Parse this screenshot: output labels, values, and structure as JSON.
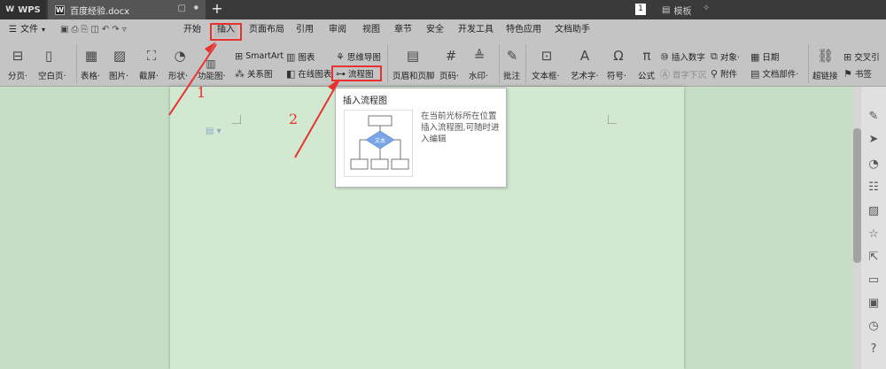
{
  "titlebar": {
    "app_name": "WPS",
    "doc_tab": "百度经验.docx",
    "doc_tab_icon": "W",
    "close_glyph": "▢",
    "dot_glyph": "●",
    "page_count": "1",
    "template_label": "模板"
  },
  "menubar": {
    "file_label": "文件",
    "tabs": [
      "开始",
      "插入",
      "页面布局",
      "引用",
      "审阅",
      "视图",
      "章节",
      "安全",
      "开发工具",
      "特色应用",
      "文档助手"
    ],
    "active_tab": "插入"
  },
  "ribbon": {
    "page_break": "分页·",
    "blank_page": "空白页·",
    "table": "表格·",
    "picture": "图片·",
    "screenshot": "截屏·",
    "shape": "形状·",
    "function_chart": "功能图·",
    "smartart": "SmartArt",
    "chart": "图表",
    "mind_map": "思维导图",
    "relation_map": "关系图",
    "online_chart": "在线图表",
    "flowchart": "流程图",
    "header_footer": "页眉和页脚",
    "page_number": "页码·",
    "watermark": "水印·",
    "comment": "批注",
    "text_box": "文本框·",
    "word_art": "艺术字·",
    "symbol": "符号·",
    "formula": "公式",
    "insert_number": "插入数字",
    "object": "对象·",
    "date": "日期",
    "drop_cap": "首字下沉",
    "attachment": "附件",
    "doc_parts": "文档部件·",
    "hyperlink": "超链接",
    "cross_ref": "交叉引",
    "bookmark": "书签"
  },
  "popup": {
    "title": "插入流程图",
    "preview_label": "文本",
    "description": "在当前光标所在位置插入流程图,可随时进入编辑"
  },
  "annotations": {
    "step1": "1",
    "step2": "2",
    "color": "#e8322f"
  }
}
